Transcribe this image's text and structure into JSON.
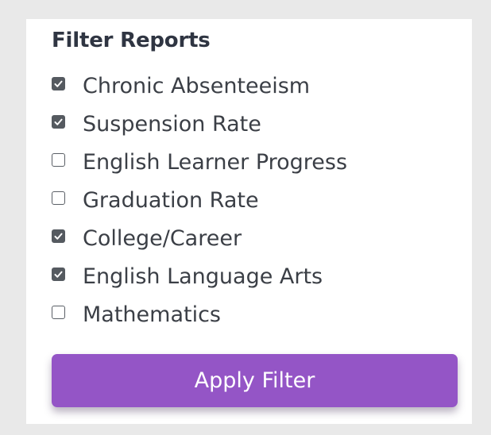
{
  "panel": {
    "title": "Filter Reports"
  },
  "filters": [
    {
      "label": "Chronic Absenteeism",
      "checked": true
    },
    {
      "label": "Suspension Rate",
      "checked": true
    },
    {
      "label": "English Learner Progress",
      "checked": false
    },
    {
      "label": "Graduation Rate",
      "checked": false
    },
    {
      "label": "College/Career",
      "checked": true
    },
    {
      "label": "English Language Arts",
      "checked": true
    },
    {
      "label": "Mathematics",
      "checked": false
    }
  ],
  "actions": {
    "apply_label": "Apply Filter"
  },
  "colors": {
    "accent": "#9455c6",
    "checkbox_fill": "#555a60",
    "page_background": "#e9e9e9",
    "panel_background": "#ffffff"
  }
}
